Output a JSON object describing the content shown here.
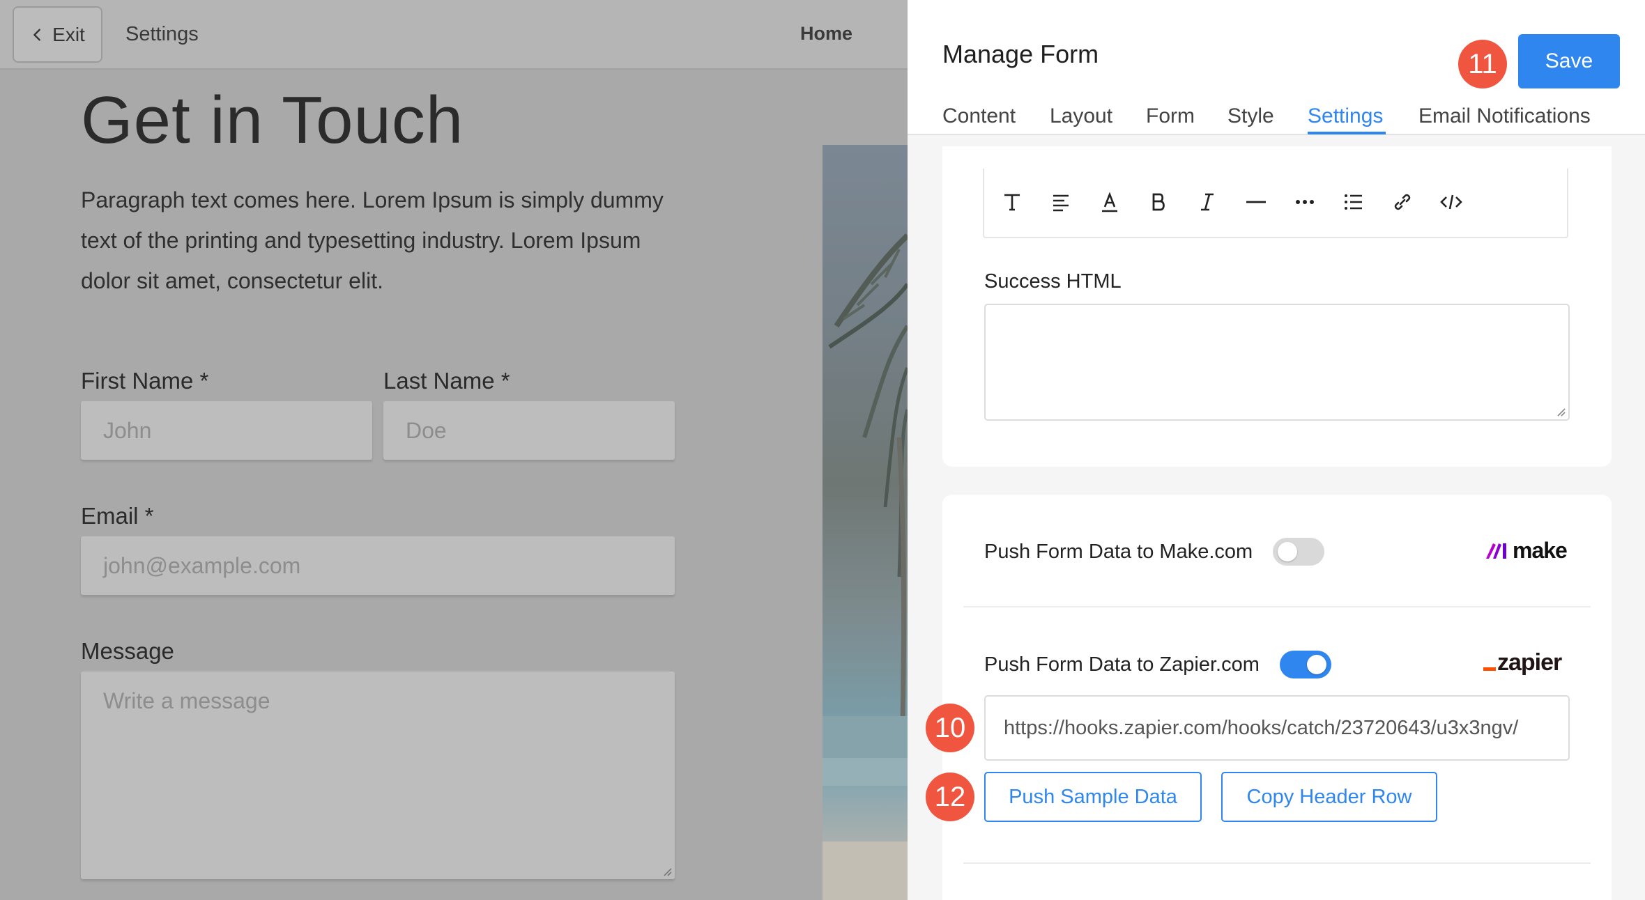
{
  "topbar": {
    "exit_label": "Exit",
    "settings_label": "Settings",
    "home_label": "Home"
  },
  "preview": {
    "heading": "Get in Touch",
    "paragraph": "Paragraph text comes here. Lorem Ipsum is simply dummy text of the printing and typesetting industry. Lorem Ipsum dolor sit amet, consectetur elit.",
    "fields": {
      "first_name": {
        "label": "First Name *",
        "placeholder": "John"
      },
      "last_name": {
        "label": "Last Name *",
        "placeholder": "Doe"
      },
      "email": {
        "label": "Email *",
        "placeholder": "john@example.com"
      },
      "message": {
        "label": "Message",
        "placeholder": "Write a message"
      }
    }
  },
  "panel": {
    "title": "Manage Form",
    "save_label": "Save",
    "tabs": [
      "Content",
      "Layout",
      "Form",
      "Style",
      "Settings",
      "Email Notifications"
    ],
    "active_tab": "Settings",
    "markers": {
      "save": "11",
      "webhook": "10",
      "push_sample": "12"
    },
    "editor_toolbar_icons": [
      "text-style-icon",
      "align-icon",
      "text-color-icon",
      "bold-icon",
      "italic-icon",
      "horizontal-rule-icon",
      "more-icon",
      "list-icon",
      "link-icon",
      "code-icon"
    ],
    "success_html_label": "Success HTML",
    "make": {
      "label": "Push Form Data to Make.com",
      "enabled": false,
      "logo_text": "make"
    },
    "zapier": {
      "label": "Push Form Data to Zapier.com",
      "enabled": true,
      "logo_text": "zapier",
      "webhook_url": "https://hooks.zapier.com/hooks/catch/23720643/u3x3ngv/",
      "push_sample_label": "Push Sample Data",
      "copy_header_label": "Copy Header Row"
    }
  },
  "colors": {
    "accent": "#2f86ee",
    "marker": "#f0553f",
    "zapier_orange": "#ff4f00",
    "make_purple": "#6d00cc"
  }
}
